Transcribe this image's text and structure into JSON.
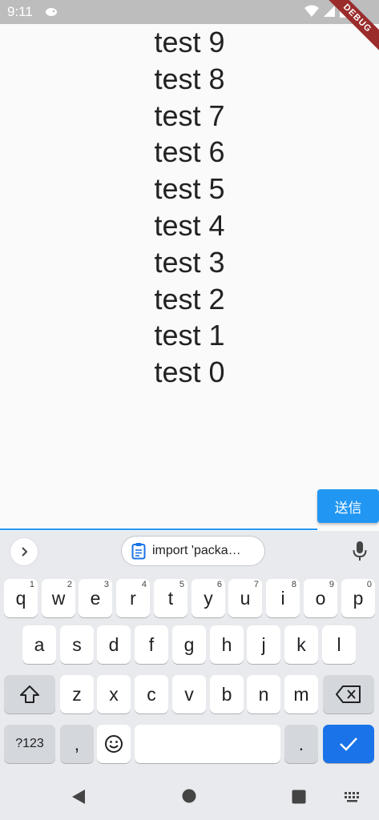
{
  "status_bar": {
    "time": "9:11",
    "debug_label": "DEBUG"
  },
  "messages": [
    "test 9",
    "test 8",
    "test 7",
    "test 6",
    "test 5",
    "test 4",
    "test 3",
    "test 2",
    "test 1",
    "test 0"
  ],
  "composer": {
    "input_value": "",
    "send_label": "送信"
  },
  "keyboard": {
    "clipboard_chip": "import 'packa…",
    "row1": [
      {
        "label": "q",
        "hint": "1"
      },
      {
        "label": "w",
        "hint": "2"
      },
      {
        "label": "e",
        "hint": "3"
      },
      {
        "label": "r",
        "hint": "4"
      },
      {
        "label": "t",
        "hint": "5"
      },
      {
        "label": "y",
        "hint": "6"
      },
      {
        "label": "u",
        "hint": "7"
      },
      {
        "label": "i",
        "hint": "8"
      },
      {
        "label": "o",
        "hint": "9"
      },
      {
        "label": "p",
        "hint": "0"
      }
    ],
    "row2": [
      "a",
      "s",
      "d",
      "f",
      "g",
      "h",
      "j",
      "k",
      "l"
    ],
    "row3": [
      "z",
      "x",
      "c",
      "v",
      "b",
      "n",
      "m"
    ],
    "symbols_label": "?123",
    "comma_label": ",",
    "period_label": "."
  },
  "icons": {
    "expand": "chevron-right-icon",
    "clipboard": "clipboard-icon",
    "mic": "mic-icon",
    "shift": "shift-icon",
    "backspace": "backspace-icon",
    "emoji": "emoji-icon",
    "enter": "checkmark-icon",
    "nav_back": "back-triangle-icon",
    "nav_home": "home-circle-icon",
    "nav_recents": "recents-square-icon",
    "nav_keyboard": "keyboard-switch-icon"
  },
  "colors": {
    "accent": "#2196f3",
    "enter_key": "#1a73e8",
    "debug_ribbon": "#9b2c2c"
  }
}
